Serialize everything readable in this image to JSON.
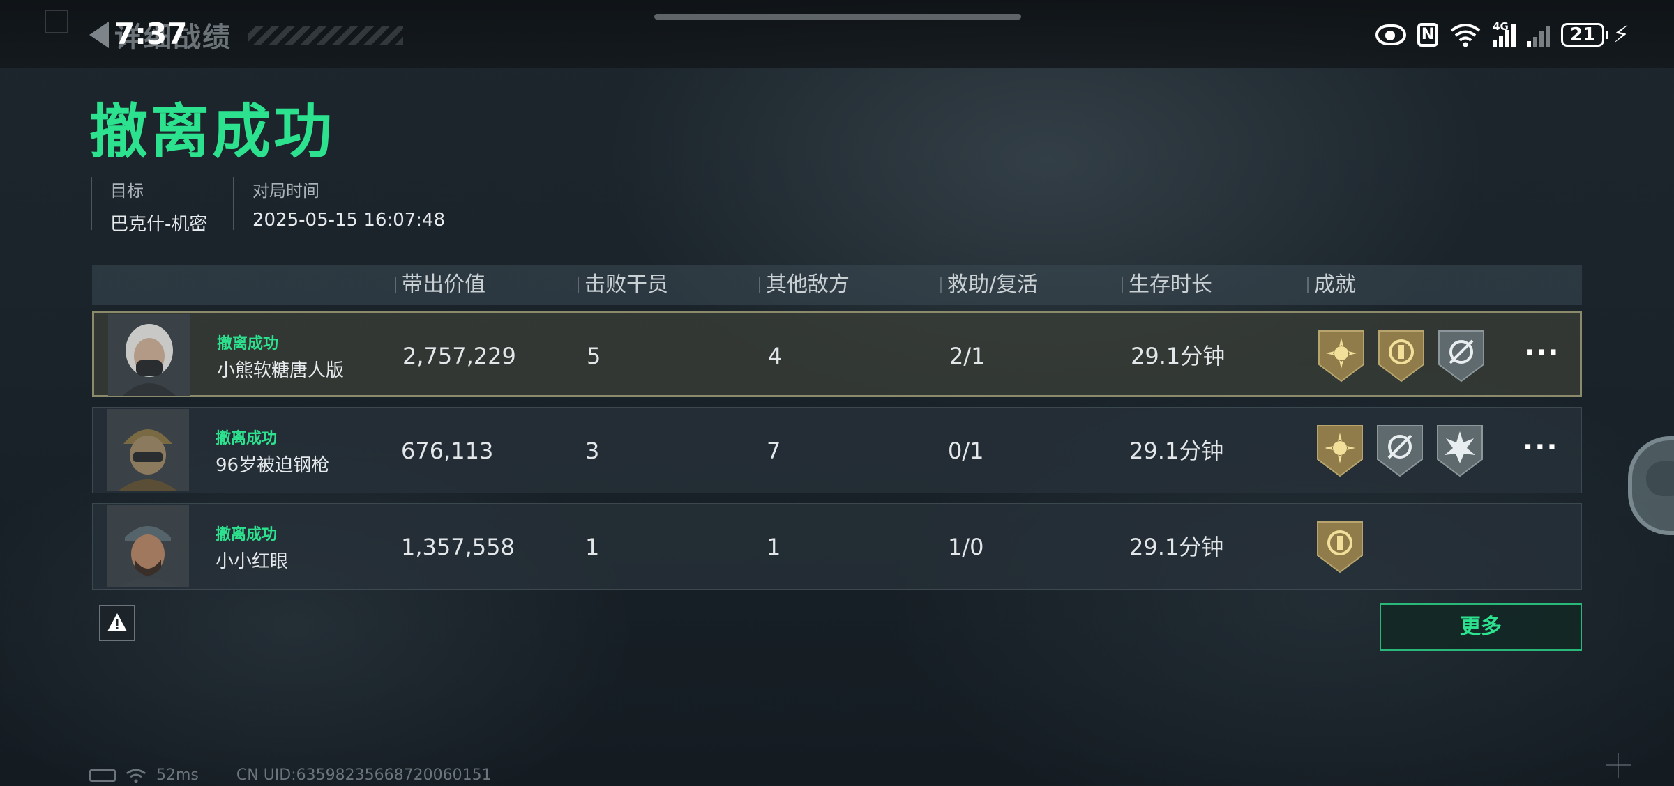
{
  "status_bar": {
    "time": "7:37",
    "signal_label": "4G",
    "battery": "21"
  },
  "nav": {
    "back_title": "详细战绩"
  },
  "header": {
    "result_title": "撤离成功",
    "target_label": "目标",
    "target_value": "巴克什-机密",
    "time_label": "对局时间",
    "time_value": "2025-05-15 16:07:48"
  },
  "table": {
    "columns": [
      "带出价值",
      "击败干员",
      "其他敌方",
      "救助/复活",
      "生存时长",
      "成就"
    ],
    "rows": [
      {
        "status": "撤离成功",
        "name": "小熊软糖唐人版",
        "value": "2,757,229",
        "kills": "5",
        "other": "4",
        "assist": "2/1",
        "survival": "29.1分钟",
        "achievements": [
          "sun-badge-icon",
          "emblem-badge-icon",
          "crosshair-badge-icon"
        ],
        "self": true
      },
      {
        "status": "撤离成功",
        "name": "96岁被迫钢枪",
        "value": "676,113",
        "kills": "3",
        "other": "7",
        "assist": "0/1",
        "survival": "29.1分钟",
        "achievements": [
          "sun-badge-icon",
          "crosshair-badge-icon",
          "burst-badge-icon"
        ],
        "self": false
      },
      {
        "status": "撤离成功",
        "name": "小小红眼",
        "value": "1,357,558",
        "kills": "1",
        "other": "1",
        "assist": "1/0",
        "survival": "29.1分钟",
        "achievements": [
          "emblem-badge-icon"
        ],
        "self": false
      }
    ]
  },
  "buttons": {
    "more": "更多",
    "row_more": "···"
  },
  "footer": {
    "ping": "52ms",
    "uid": "CN UID:63598235668720060151"
  },
  "colors": {
    "accent_green": "#2de28f",
    "badge_gold": "#8f7c4a",
    "badge_silver": "#5f6a6e"
  }
}
